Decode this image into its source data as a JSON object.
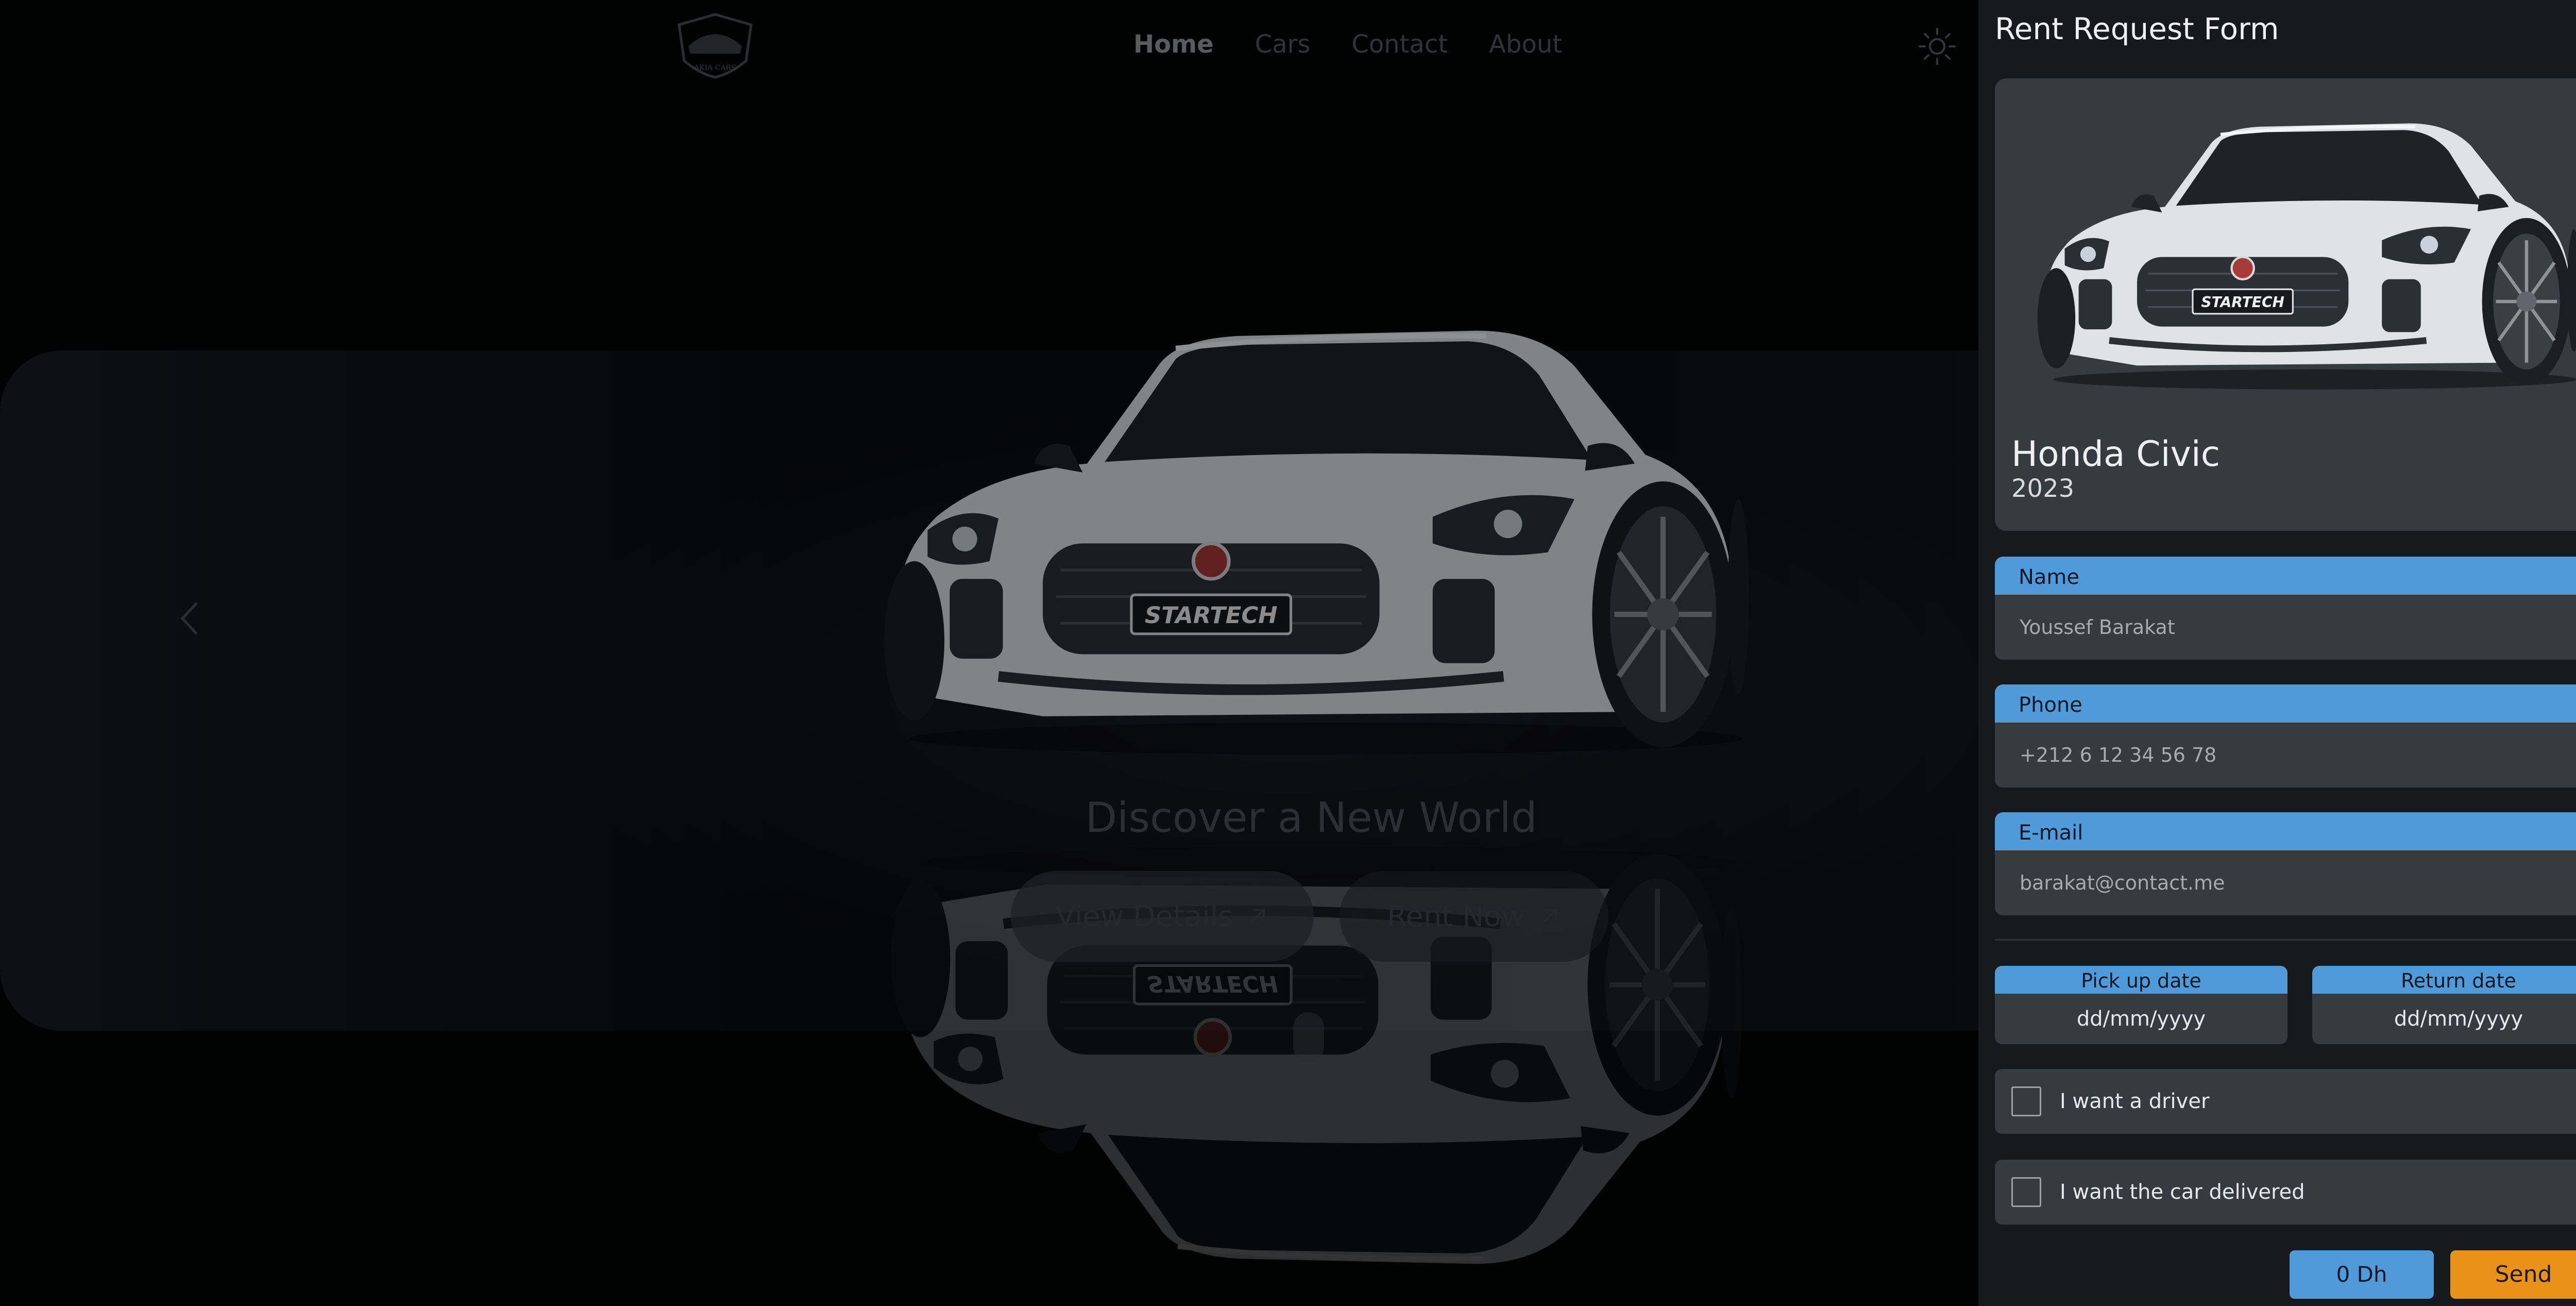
{
  "header": {
    "nav": [
      "Home",
      "Cars",
      "Contact",
      "About"
    ],
    "active": "Home",
    "logo_icon": "car-shield-logo",
    "theme_icon": "sun-icon"
  },
  "hero": {
    "tagline": "Discover a New World",
    "view_details_label": "View Details",
    "rent_now_label": "Rent Now",
    "arrow_icon": "arrow-up-right-icon",
    "plate_text": "STARTECH"
  },
  "form": {
    "title": "Rent Request Form",
    "close_icon": "close-icon",
    "car": {
      "name": "Honda Civic",
      "year": "2023"
    },
    "fields": {
      "name": {
        "label": "Name",
        "placeholder": "Youssef Barakat"
      },
      "phone": {
        "label": "Phone",
        "placeholder": "+212 6 12 34 56 78"
      },
      "email": {
        "label": "E-mail",
        "placeholder": "barakat@contact.me"
      }
    },
    "pickup": {
      "label": "Pick up date",
      "value": "dd/mm/yyyy"
    },
    "return": {
      "label": "Return date",
      "value": "dd/mm/yyyy"
    },
    "options": {
      "driver": "I want a driver",
      "delivery": "I want the car delivered"
    },
    "price": "0 Dh",
    "send_label": "Send"
  },
  "colors": {
    "accent_blue": "#4f9bd9",
    "accent_orange": "#e8921a",
    "panel_bg": "#18191c",
    "field_bg": "#363a41"
  }
}
